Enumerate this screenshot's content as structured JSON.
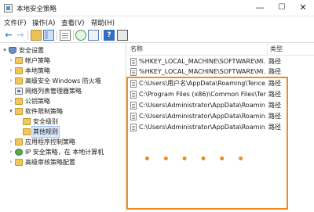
{
  "window": {
    "title": "本地安全策略",
    "minimize_glyph": "—",
    "maximize_glyph": "☐",
    "close_glyph": "✕"
  },
  "menu": {
    "file": "文件(F)",
    "action": "操作(A)",
    "view": "查看(V)",
    "help": "帮助(H)"
  },
  "toolbar": {
    "back_glyph": "←",
    "forward_glyph": "→",
    "help_glyph": "?",
    "icons": [
      "back-icon",
      "forward-icon",
      "up-folder-icon",
      "show-hide-tree-icon",
      "properties-icon",
      "refresh-icon",
      "export-list-icon",
      "help-icon",
      "console-icon"
    ]
  },
  "tree": {
    "expander_expanded": "▾",
    "expander_collapsed": "›",
    "items": [
      {
        "label": "安全设置",
        "expander": "▾"
      },
      {
        "label": "帐户策略",
        "expander": "›"
      },
      {
        "label": "本地策略",
        "expander": "›"
      },
      {
        "label": "高级安全 Windows 防火墙",
        "expander": "›"
      },
      {
        "label": "网络列表管理器策略",
        "expander": ""
      },
      {
        "label": "公钥策略",
        "expander": "›"
      },
      {
        "label": "软件限制策略",
        "expander": "▾"
      },
      {
        "label": "安全级别",
        "expander": ""
      },
      {
        "label": "其他规则",
        "expander": "",
        "selected": true
      },
      {
        "label": "应用程序控制策略",
        "expander": "›"
      },
      {
        "label": "IP 安全策略，在 本地计算机",
        "expander": "›"
      },
      {
        "label": "高级审核策略配置",
        "expander": "›"
      }
    ]
  },
  "list": {
    "columns": {
      "name": "名称",
      "type": "类型"
    },
    "rows": [
      {
        "name": "%HKEY_LOCAL_MACHINE\\SOFTWARE\\Mi...",
        "type": "路径"
      },
      {
        "name": "%HKEY_LOCAL_MACHINE\\SOFTWARE\\Mi...",
        "type": "路径"
      },
      {
        "name": "C:\\Users\\用户名\\AppData\\Roaming\\Tence...",
        "type": "路径"
      },
      {
        "name": "C:\\Program Files (x86)\\Common Files\\Ten...",
        "type": "路径"
      },
      {
        "name": "C:\\Users\\Administrator\\AppData\\Roamin...",
        "type": "路径"
      },
      {
        "name": "C:\\Users\\Administrator\\AppData\\Roamin...",
        "type": "路径"
      },
      {
        "name": "C:\\Users\\Administrator\\AppData\\Roamin...",
        "type": "路径"
      }
    ]
  },
  "annotation": {
    "ellipsis": "• • • • • •",
    "highlight_color": "#f08c1e"
  },
  "colors": {
    "selection_bg": "#d9e8fa",
    "accent_blue": "#3a78c8",
    "folder_yellow": "#f0c75e"
  }
}
